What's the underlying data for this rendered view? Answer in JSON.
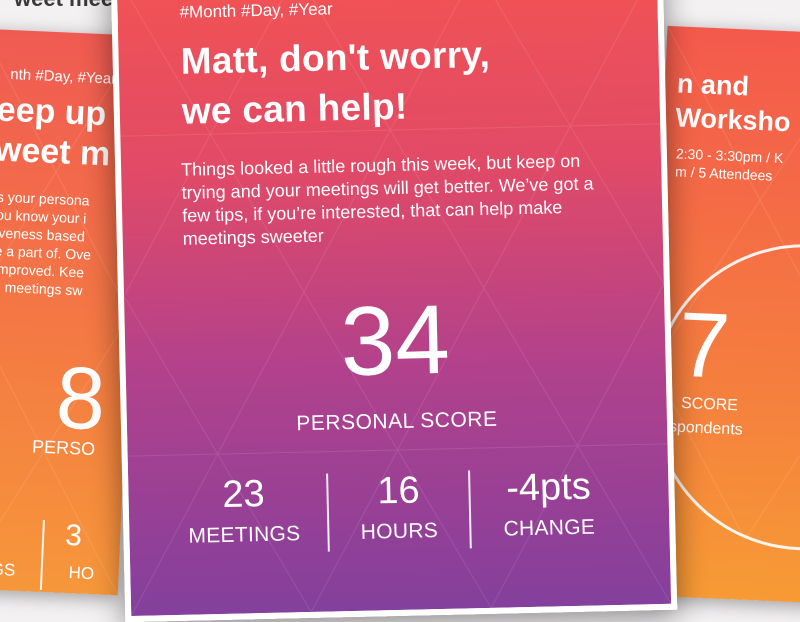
{
  "top_strip": {
    "clipped_text": "weet meetin"
  },
  "left_card": {
    "date": "nth #Day, #Year",
    "title_lines": [
      "eep up",
      "weet m"
    ],
    "body_lines": [
      "s your persona",
      "ou know your i",
      "iveness based",
      "e a part of. Ove",
      "improved. Kee",
      "g meetings sw"
    ],
    "score": "8",
    "score_label": "PERSO",
    "stat_value": "3",
    "stat_label_1": "GS",
    "stat_label_2": "HO"
  },
  "main_card": {
    "date": "#Month #Day, #Year",
    "title_line_1": "Matt, don't worry,",
    "title_line_2": "we can help!",
    "body": "Things looked a little rough this week, but keep on trying and your meetings will get better. We’ve got a few tips, if you’re interested, that can help make meetings sweeter",
    "score": "34",
    "score_label": "PERSONAL SCORE",
    "stats": [
      {
        "value": "23",
        "label": "MEETINGS"
      },
      {
        "value": "16",
        "label": "HOURS"
      },
      {
        "value": "-4pts",
        "label": "CHANGE"
      }
    ]
  },
  "right_card": {
    "title_lines": [
      "n and",
      "Worksho"
    ],
    "sub_lines": [
      "2:30 - 3:30pm / K",
      "m / 5 Attendees"
    ],
    "score": "7",
    "score_label": "SCORE",
    "respondents": "espondents"
  },
  "colors": {
    "main_top": "#f25353",
    "main_bottom": "#83409c",
    "side_top": "#f05a52",
    "side_bottom": "#f6973a"
  }
}
